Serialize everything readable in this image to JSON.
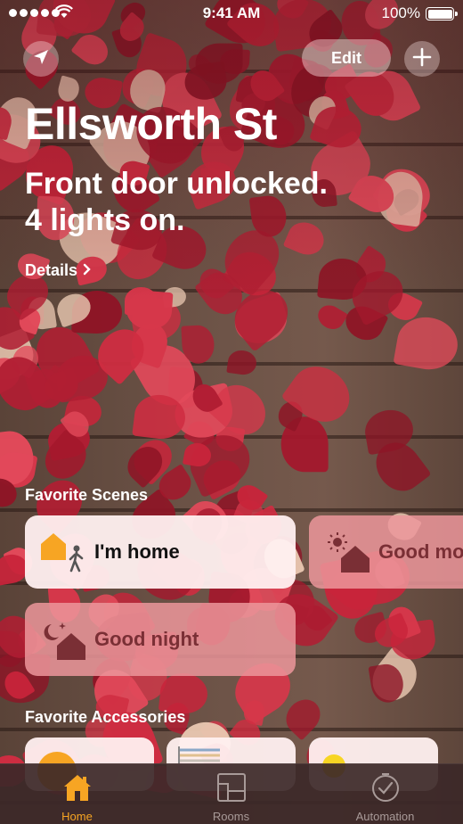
{
  "status_bar": {
    "time": "9:41 AM",
    "battery_text": "100%",
    "signal_bars": 5,
    "battery_level": 1.0
  },
  "header": {
    "edit_label": "Edit",
    "location_icon": "location-arrow-icon",
    "add_icon": "plus-icon"
  },
  "home": {
    "name": "Ellsworth St",
    "summary_line1": "Front door unlocked.",
    "summary_line2": "4 lights on.",
    "details_label": "Details"
  },
  "scenes": {
    "title": "Favorite Scenes",
    "items": [
      {
        "label": "I'm home",
        "icon": "arrive-home-icon",
        "active": true
      },
      {
        "label": "Good mo",
        "icon": "good-morning-icon",
        "active": false
      },
      {
        "label": "Good night",
        "icon": "good-night-icon",
        "active": false
      }
    ]
  },
  "accessories": {
    "title": "Favorite Accessories",
    "items": [
      {
        "icon": "lightbulb-on-icon"
      },
      {
        "icon": "window-shade-icon"
      },
      {
        "icon": "lightbulb-on-icon"
      }
    ]
  },
  "tabbar": {
    "tabs": [
      {
        "label": "Home",
        "icon": "home-icon",
        "selected": true
      },
      {
        "label": "Rooms",
        "icon": "rooms-icon",
        "selected": false
      },
      {
        "label": "Automation",
        "icon": "automation-icon",
        "selected": false
      }
    ]
  },
  "colors": {
    "accent": "#f7a523",
    "tile_active": "#fff0f0",
    "tile_inactive": "#ec969b",
    "leaf_red": "#c8243a"
  }
}
